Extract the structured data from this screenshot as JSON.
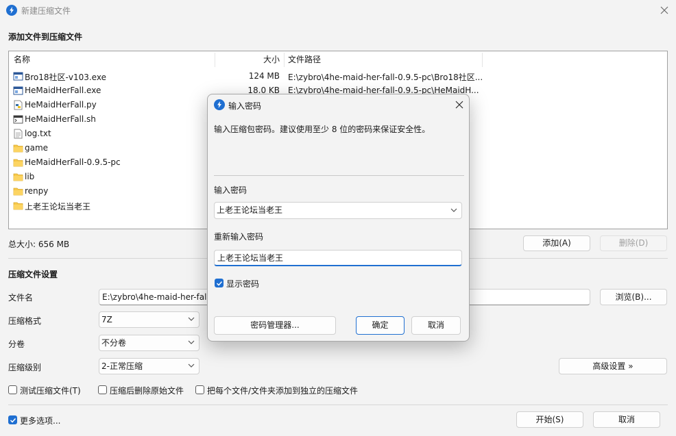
{
  "window": {
    "title": "新建压缩文件",
    "accent": "#1f6fd1"
  },
  "add_section": {
    "title": "添加文件到压缩文件",
    "columns": {
      "name": "名称",
      "size": "大小",
      "path": "文件路径"
    },
    "files": [
      {
        "name": "Bro18社区-v103.exe",
        "size": "124 MB",
        "path": "E:\\zybro\\4he-maid-her-fall-0.9.5-pc\\Bro18社区...",
        "icon": "exe-file-icon"
      },
      {
        "name": "HeMaidHerFall.exe",
        "size": "18.0 KB",
        "path": "E:\\zybro\\4he-maid-her-fall-0.9.5-pc\\HeMaidH...",
        "icon": "exe-file-icon"
      },
      {
        "name": "HeMaidHerFall.py",
        "size": "",
        "path": "",
        "icon": "python-file-icon"
      },
      {
        "name": "HeMaidHerFall.sh",
        "size": "",
        "path": "",
        "icon": "shell-file-icon"
      },
      {
        "name": "log.txt",
        "size": "",
        "path": "",
        "icon": "text-file-icon"
      },
      {
        "name": "game",
        "size": "",
        "path": "",
        "icon": "folder-icon"
      },
      {
        "name": "HeMaidHerFall-0.9.5-pc",
        "size": "",
        "path": "",
        "icon": "folder-icon"
      },
      {
        "name": "lib",
        "size": "",
        "path": "",
        "icon": "folder-icon"
      },
      {
        "name": "renpy",
        "size": "",
        "path": "",
        "icon": "folder-icon"
      },
      {
        "name": "上老王论坛当老王",
        "size": "",
        "path": "",
        "icon": "folder-icon"
      }
    ],
    "total_size": "总大小: 656 MB",
    "add_button": "添加(A)",
    "delete_button": "删除(D)"
  },
  "settings": {
    "title": "压缩文件设置",
    "filename_label": "文件名",
    "filename_value": "E:\\zybro\\4he-maid-her-fall",
    "browse_button": "浏览(B)...",
    "format_label": "压缩格式",
    "format_value": "7Z",
    "split_label": "分卷",
    "split_value": "不分卷",
    "level_label": "压缩级别",
    "level_value": "2-正常压缩",
    "advanced_button": "高级设置 »",
    "test_checkbox": "测试压缩文件(T)",
    "delete_after_checkbox": "压缩后删除原始文件",
    "separate_checkbox": "把每个文件/文件夹添加到独立的压缩文件"
  },
  "footer": {
    "more_options": "更多选项...",
    "start_button": "开始(S)",
    "cancel_button": "取消"
  },
  "dialog": {
    "title": "输入密码",
    "description": "输入压缩包密码。建议使用至少 8 位的密码来保证安全性。",
    "password_label": "输入密码",
    "password_value": "上老王论坛当老王",
    "repeat_label": "重新输入密码",
    "repeat_value": "上老王论坛当老王",
    "show_password": "显示密码",
    "manager_button": "密码管理器...",
    "ok_button": "确定",
    "cancel_button": "取消"
  }
}
